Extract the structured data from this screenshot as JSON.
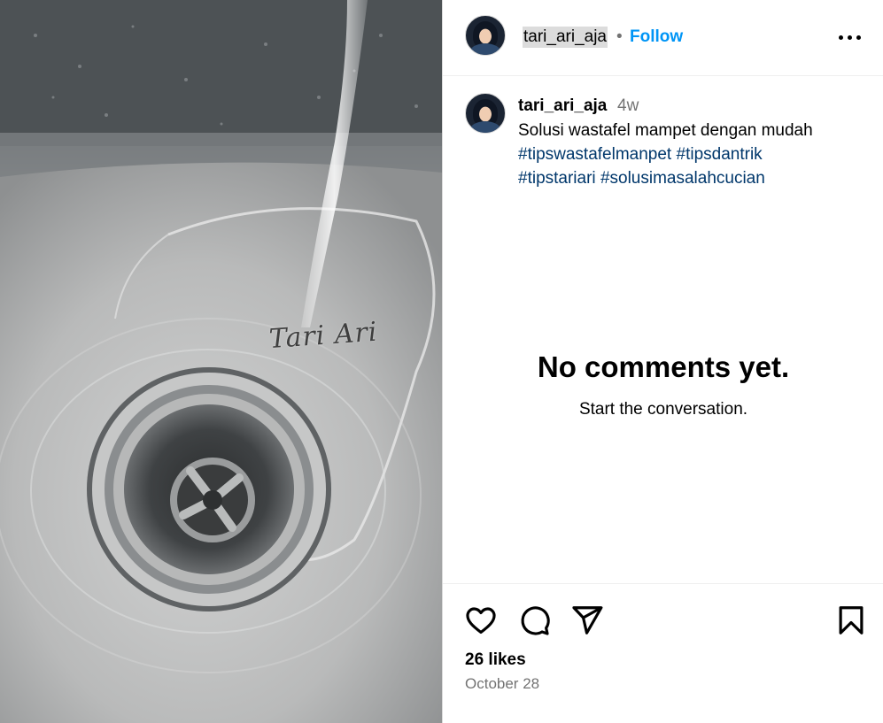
{
  "media": {
    "watermark": "Tari Ari"
  },
  "header": {
    "username": "tari_ari_aja",
    "separator": "•",
    "follow_label": "Follow"
  },
  "caption": {
    "username": "tari_ari_aja",
    "time": "4w",
    "text": "Solusi wastafel mampet dengan mudah",
    "hashtags": [
      "#tipswastafelmanpet",
      "#tipsdantrik",
      "#tipstariari",
      "#solusimasalahcucian"
    ]
  },
  "comments": {
    "empty_title": "No comments yet.",
    "empty_subtitle": "Start the conversation."
  },
  "footer": {
    "likes": "26 likes",
    "date": "October 28"
  }
}
